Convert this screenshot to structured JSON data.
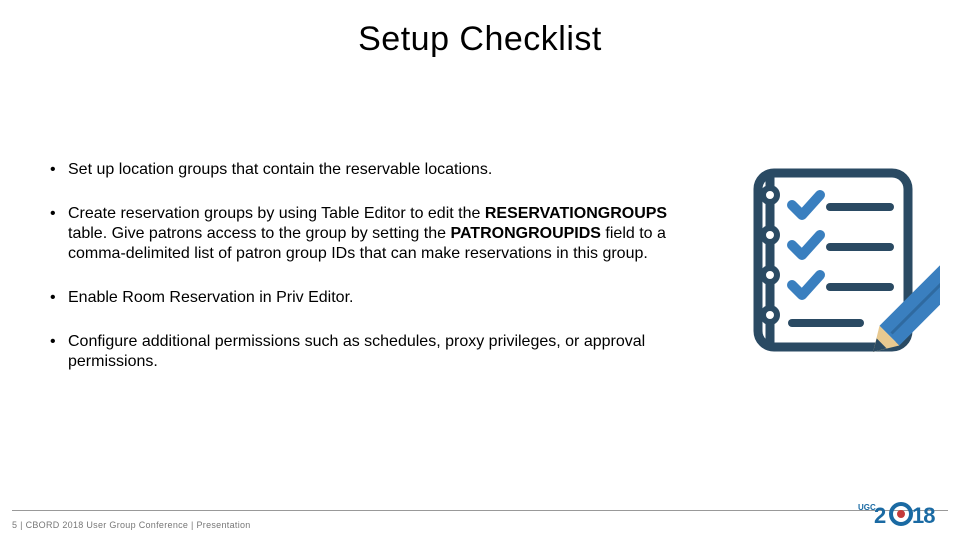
{
  "title": "Setup Checklist",
  "bullets": {
    "b1": "Set up location groups that contain the reservable locations.",
    "b2a": "Create reservation groups by using Table Editor to edit the ",
    "b2b": "RESERVATIONGROUPS",
    "b2c": " table. Give patrons access to the group by setting the ",
    "b2d": "PATRONGROUPIDS",
    "b2e": " field to a comma-delimited list of patron group IDs that can make reservations in this group.",
    "b3": "Enable Room Reservation in Priv Editor.",
    "b4": "Configure additional permissions such as schedules, proxy privileges, or approval permissions."
  },
  "footer": {
    "page": "5",
    "sep": " |  ",
    "text": "CBORD 2018 User Group Conference | Presentation"
  },
  "logo": {
    "ugc": "UGC",
    "year": "2018"
  }
}
